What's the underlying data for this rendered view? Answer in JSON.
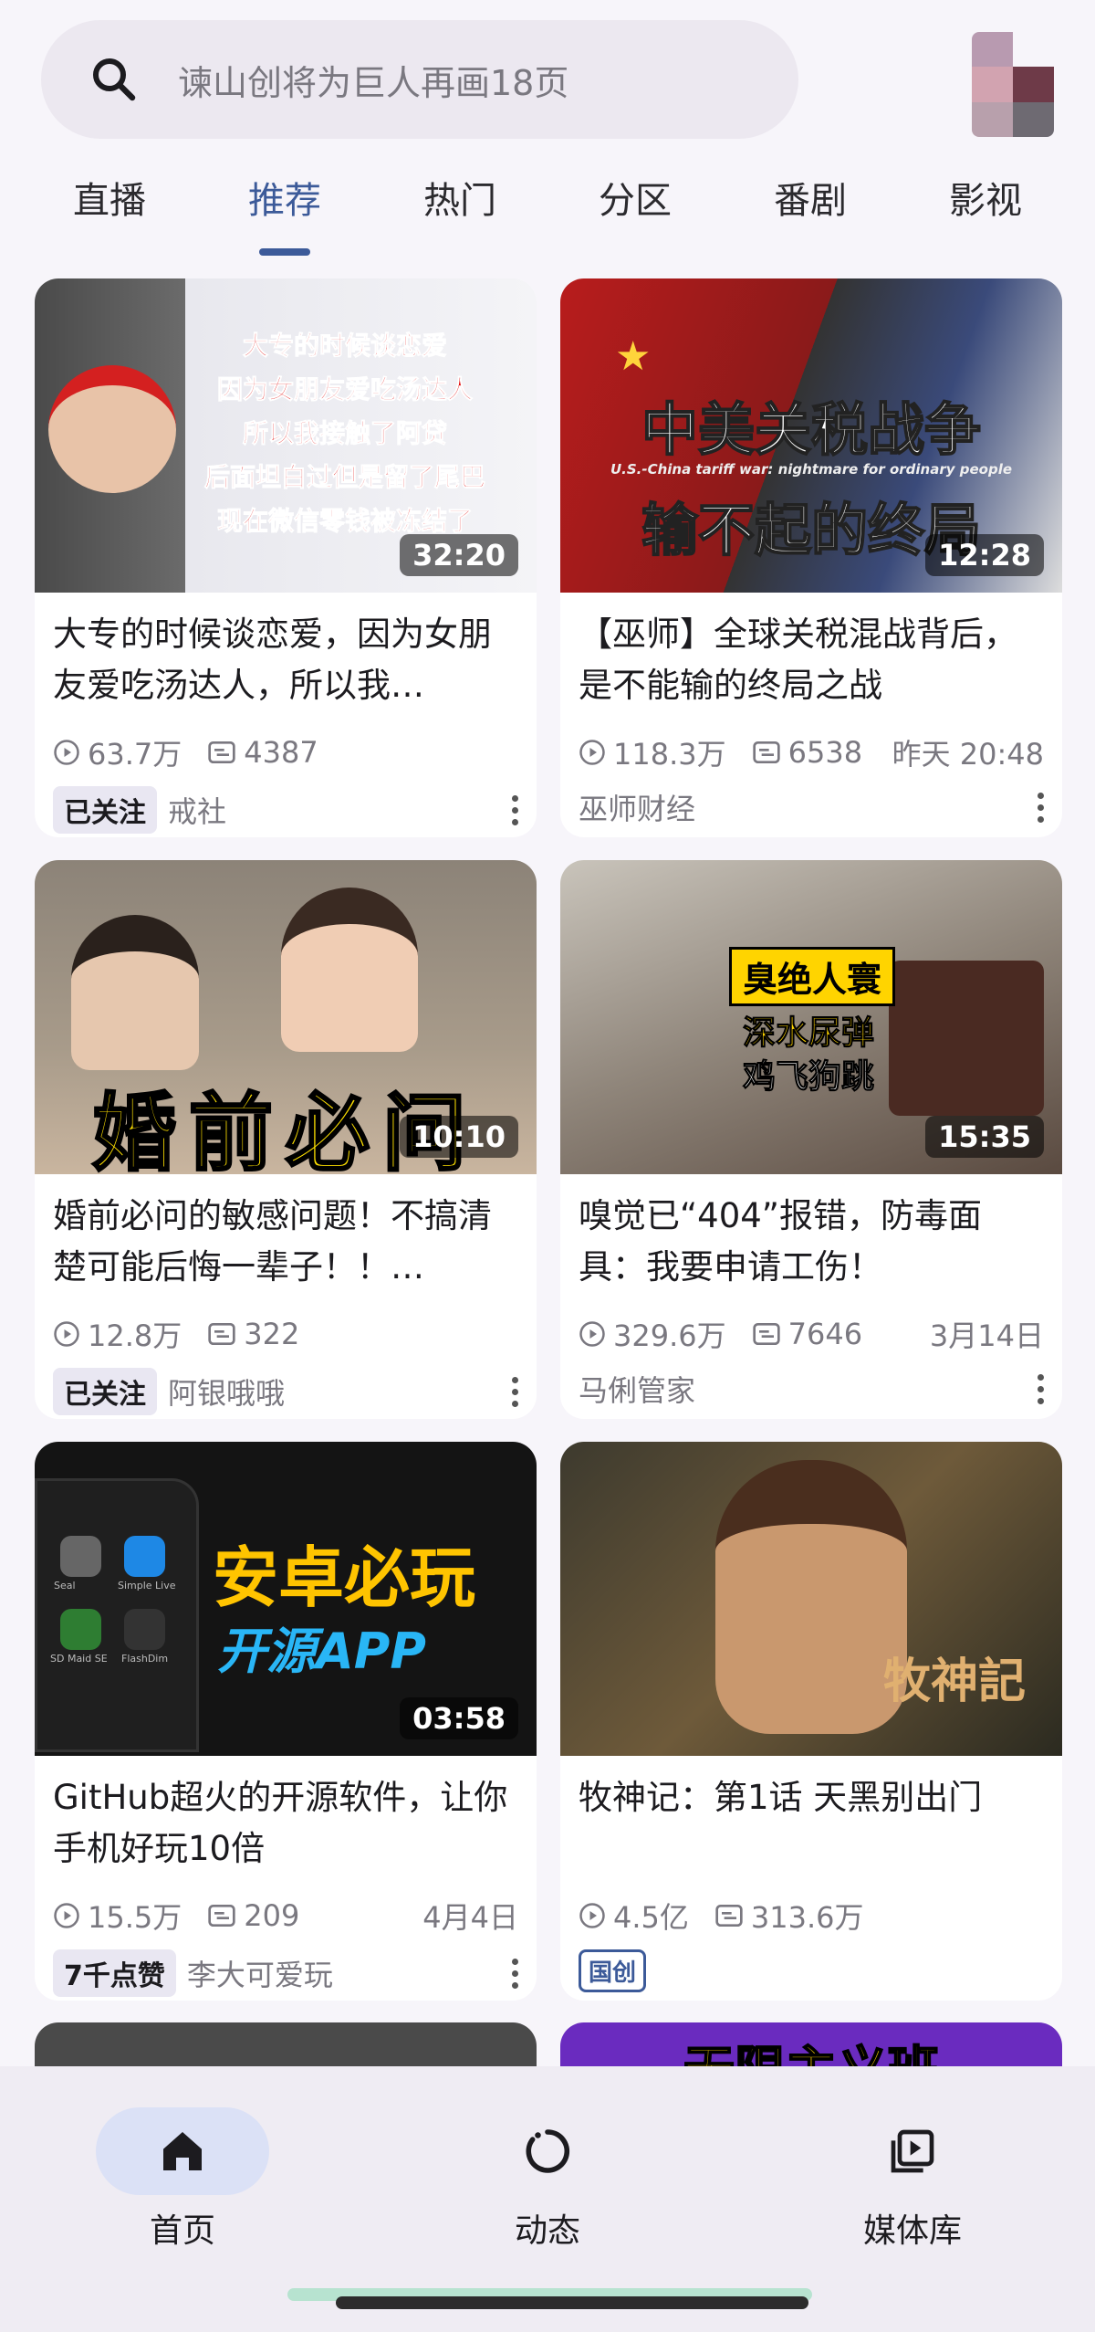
{
  "search": {
    "placeholder": "谏山创将为巨人再画18页"
  },
  "tabs": [
    {
      "label": "直播",
      "active": false
    },
    {
      "label": "推荐",
      "active": true
    },
    {
      "label": "热门",
      "active": false
    },
    {
      "label": "分区",
      "active": false
    },
    {
      "label": "番剧",
      "active": false
    },
    {
      "label": "影视",
      "active": false
    }
  ],
  "videos": [
    {
      "duration": "32:20",
      "thumb_lines": [
        "大专的时候谈恋爱",
        "因为女朋友爱吃汤达人",
        "所以我接触了阿贷",
        "后面坦白过但是留了尾巴",
        "现在微信零钱被冻结了"
      ],
      "title": "大专的时候谈恋爱，因为女朋友爱吃汤达人，所以我…",
      "views": "63.7万",
      "danmaku": "4387",
      "date": "",
      "badge": "已关注",
      "author": "戒社"
    },
    {
      "duration": "12:28",
      "thumb_lines": [
        "中美关税战争",
        "U.S.-China tariff war: nightmare for ordinary people",
        "输不起的终局"
      ],
      "title": "【巫师】全球关税混战背后，是不能输的终局之战",
      "views": "118.3万",
      "danmaku": "6538",
      "date": "昨天 20:48",
      "badge": "",
      "author": "巫师财经"
    },
    {
      "duration": "10:10",
      "thumb_lines": [
        "婚前必问"
      ],
      "title": "婚前必问的敏感问题！不搞清楚可能后悔一辈子！！…",
      "views": "12.8万",
      "danmaku": "322",
      "date": "",
      "badge": "已关注",
      "author": "阿银哦哦"
    },
    {
      "duration": "15:35",
      "thumb_lines": [
        "臭绝人寰",
        "深水尿弹",
        "鸡飞狗跳"
      ],
      "title": "嗅觉已“404”报错，防毒面具：我要申请工伤！",
      "views": "329.6万",
      "danmaku": "7646",
      "date": "3月14日",
      "badge": "",
      "author": "马俐管家"
    },
    {
      "duration": "03:58",
      "thumb_lines": [
        "安卓必玩",
        "开源APP"
      ],
      "thumb_apps": [
        "Seal",
        "Simple Live",
        "SD Maid SE",
        "FlashDim"
      ],
      "title": "GitHub超火的开源软件，让你手机好玩10倍",
      "views": "15.5万",
      "danmaku": "209",
      "date": "4月4日",
      "badge": "7千点赞",
      "author": "李大可爱玩"
    },
    {
      "duration": "",
      "thumb_lines": [
        "牧神記"
      ],
      "title": "牧神记：第1话 天黑别出门",
      "views": "4.5亿",
      "danmaku": "313.6万",
      "date": "",
      "badge": "国创",
      "author": ""
    }
  ],
  "partial_thumb_text": "无限主义班",
  "bottom_nav": [
    {
      "label": "首页",
      "icon": "home-icon",
      "active": true
    },
    {
      "label": "动态",
      "icon": "refresh-circle-icon",
      "active": false
    },
    {
      "label": "媒体库",
      "icon": "media-library-icon",
      "active": false
    }
  ],
  "colors": {
    "accent": "#3c5a99",
    "background": "#f7f5fa",
    "card": "#ffffff"
  }
}
